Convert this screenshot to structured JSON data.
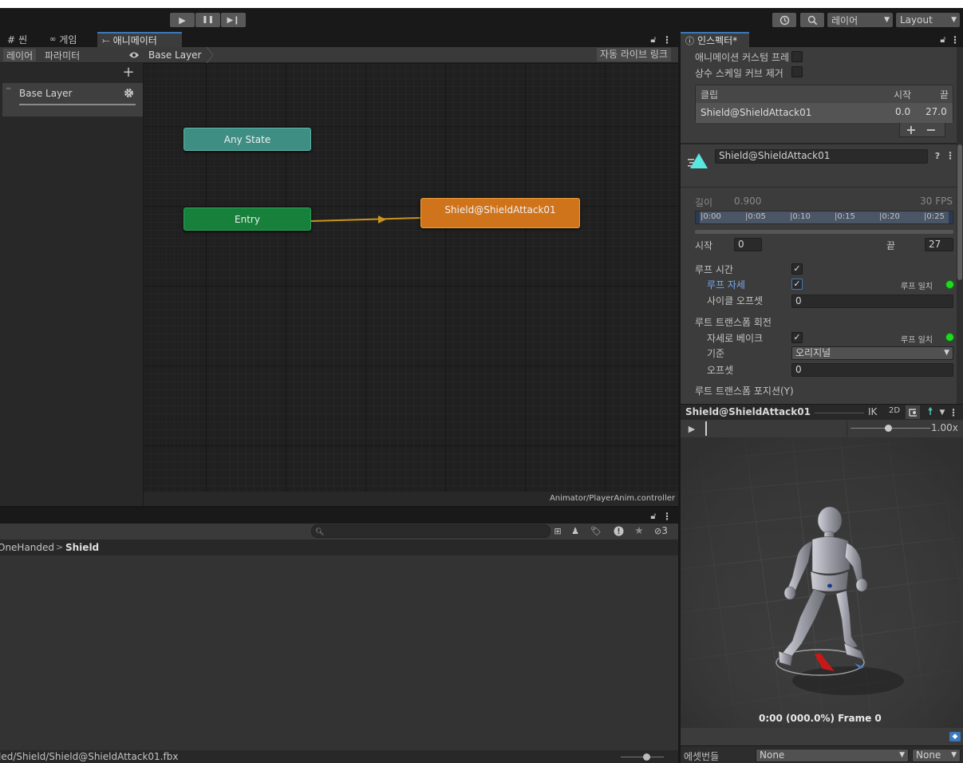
{
  "toolbar": {
    "play": "▶",
    "pause": "❚❚",
    "step": "▶❙",
    "layer_dropdown": "레이어",
    "layout_dropdown": "Layout"
  },
  "tabs": {
    "scene": "씬",
    "game": "게임",
    "animator": "애니메이터",
    "inspector": "인스펙터*"
  },
  "animator": {
    "subtabs": [
      "레이어",
      "파라미터"
    ],
    "breadcrumb": "Base Layer",
    "auto_live_link": "자동 라이브 링크",
    "layer_name": "Base Layer",
    "nodes": {
      "any_state": "Any State",
      "entry": "Entry",
      "clip": "Shield@ShieldAttack01"
    },
    "controller_path": "Animator/PlayerAnim.controller"
  },
  "project": {
    "breadcrumb_parent": "OneHanded",
    "breadcrumb_current": "Shield",
    "hidden_count": "3",
    "status_path": "led/Shield/Shield@ShieldAttack01.fbx"
  },
  "inspector": {
    "custom_frame_label": "애니메이션 커스텀 프레",
    "remove_const_label": "상수 스케일 커브 제거",
    "clip_table": {
      "headers": [
        "클립",
        "시작",
        "끝"
      ],
      "row": {
        "name": "Shield@ShieldAttack01",
        "start": "0.0",
        "end": "27.0"
      }
    },
    "clip_name": "Shield@ShieldAttack01",
    "length_label": "길이",
    "length_value": "0.900",
    "fps": "30 FPS",
    "timeline_ticks": [
      "0:00",
      "0:05",
      "0:10",
      "0:15",
      "0:20",
      "0:25"
    ],
    "start_label": "시작",
    "start_value": "0",
    "end_label": "끝",
    "end_value": "27",
    "loop_time": "루프 시간",
    "loop_pose": "루프 자세",
    "loop_match": "루프 일치",
    "cycle_offset": "사이클 오프셋",
    "cycle_offset_value": "0",
    "root_rot": "루트 트랜스폼 회전",
    "bake_pose": "자세로 베이크",
    "based_on": "기준",
    "based_on_value": "오리지널",
    "offset": "오프셋",
    "offset_value": "0",
    "root_pos_y": "루트 트랜스폼 포지션(Y)"
  },
  "preview": {
    "title": "Shield@ShieldAttack01",
    "ik": "IK",
    "twod": "2D",
    "speed": "1.00x",
    "frame_readout": "0:00 (000.0%) Frame 0",
    "asset_bundle_label": "에셋번들",
    "asset_bundle_value": "None",
    "asset_variant_value": "None"
  },
  "colors": {
    "any_state": "#3e8e84",
    "entry": "#17803a",
    "clip": "#d0741c",
    "transition": "#c8941e"
  }
}
